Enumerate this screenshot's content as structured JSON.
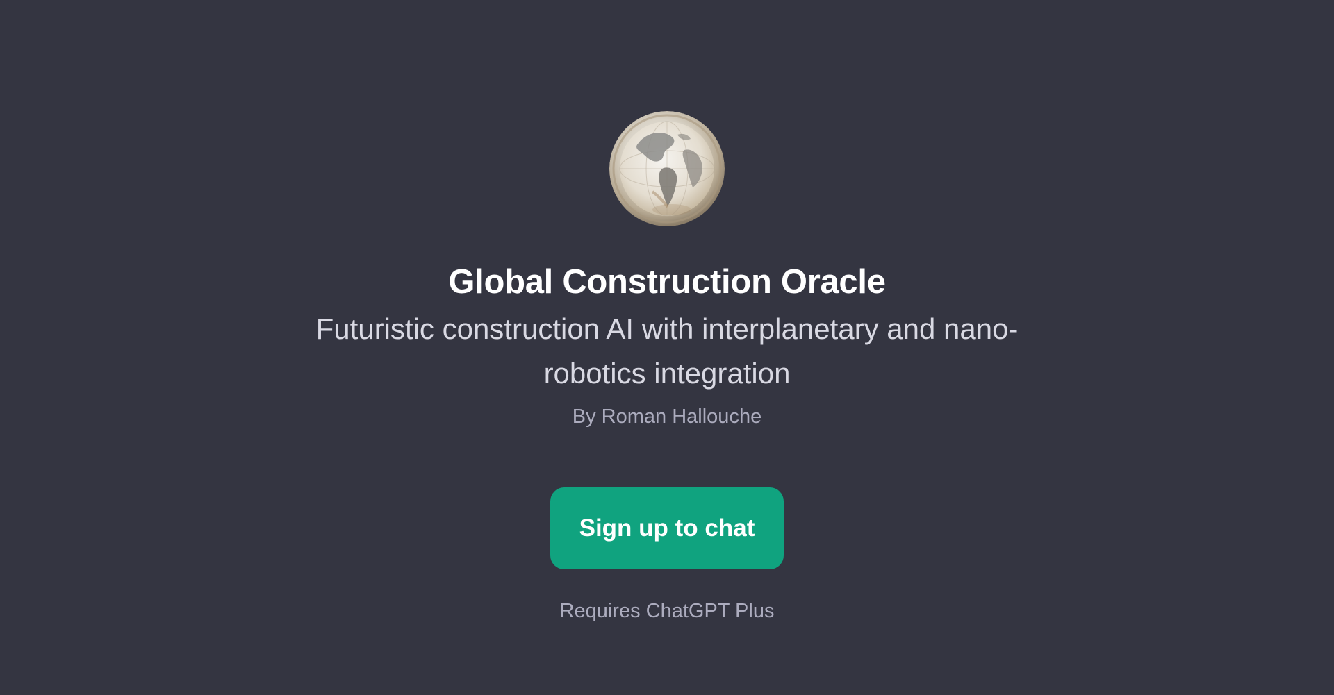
{
  "gpt": {
    "avatar_icon": "globe-avatar-icon",
    "title": "Global Construction Oracle",
    "description": "Futuristic construction AI with interplanetary and nano-robotics integration",
    "author": "By Roman Hallouche"
  },
  "cta": {
    "label": "Sign up to chat",
    "requirement": "Requires ChatGPT Plus"
  },
  "colors": {
    "background": "#343541",
    "button": "#10a37f",
    "title": "#ffffff",
    "description": "#d9d9e3",
    "muted": "#acacbe"
  }
}
